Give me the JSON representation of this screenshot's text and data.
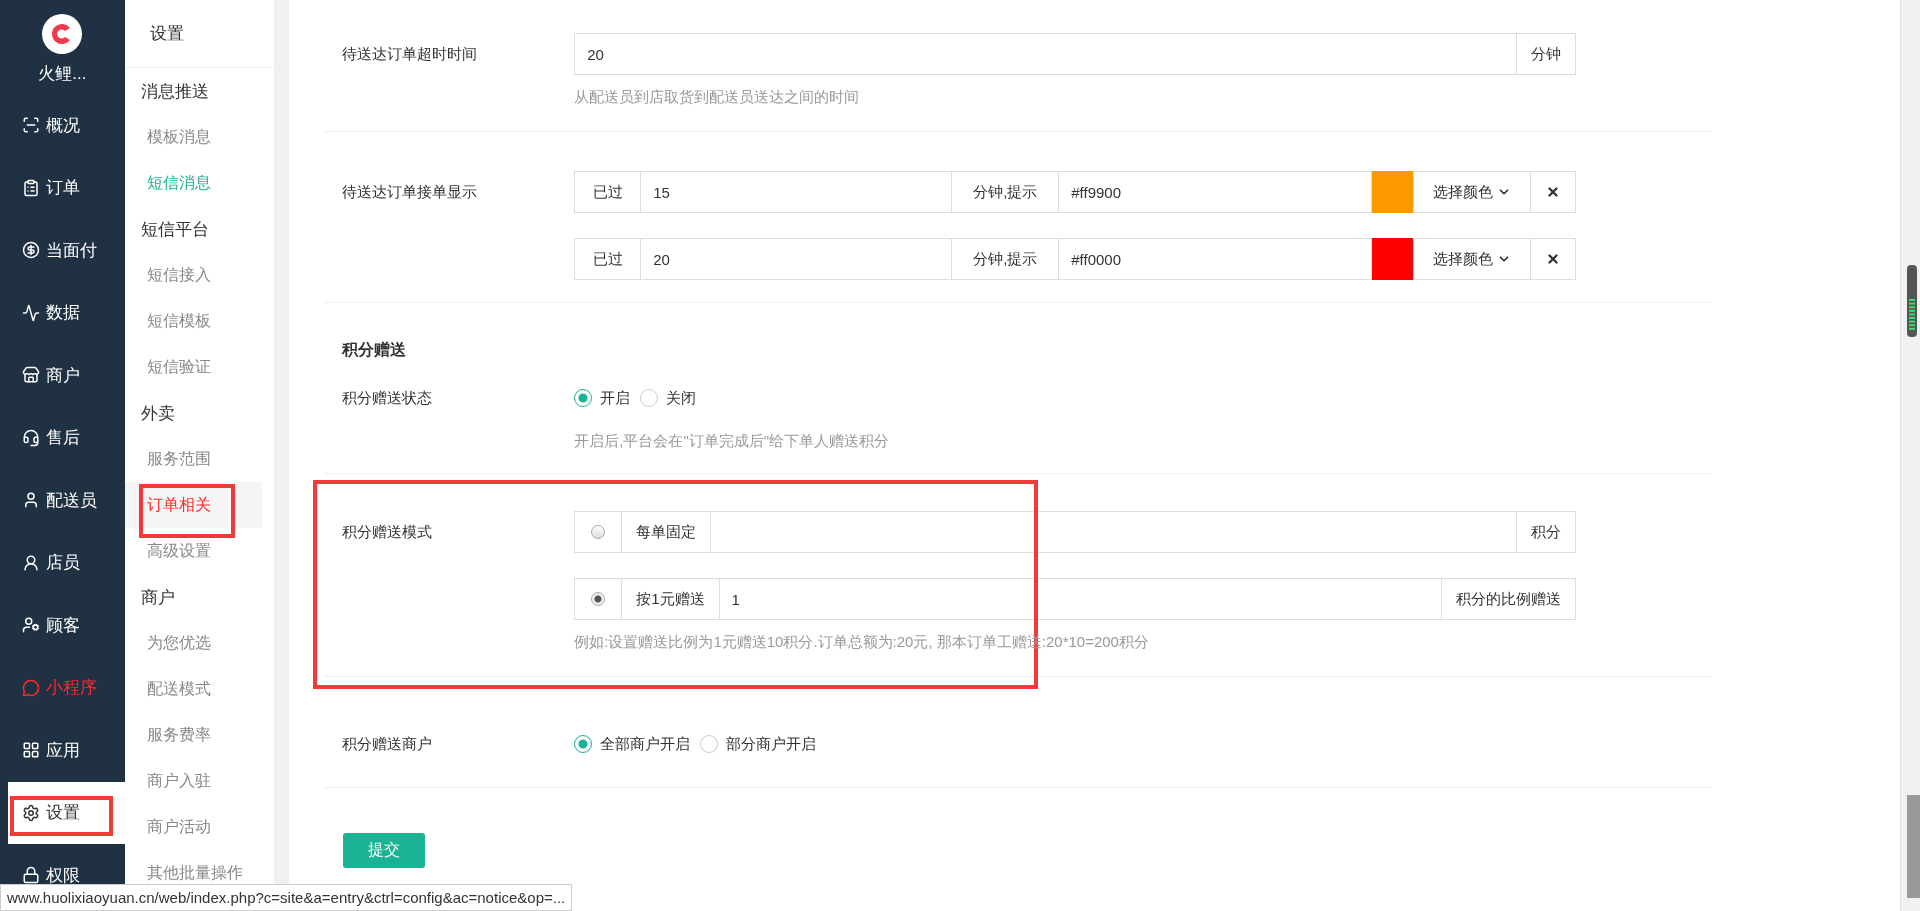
{
  "brand": {
    "name": "火鲤..."
  },
  "sidebar": {
    "items": [
      {
        "label": "概况",
        "selected": false,
        "highlighted": false
      },
      {
        "label": "订单",
        "selected": false,
        "highlighted": false
      },
      {
        "label": "当面付",
        "selected": false,
        "highlighted": false
      },
      {
        "label": "数据",
        "selected": false,
        "highlighted": false
      },
      {
        "label": "商户",
        "selected": false,
        "highlighted": false
      },
      {
        "label": "售后",
        "selected": false,
        "highlighted": false
      },
      {
        "label": "配送员",
        "selected": false,
        "highlighted": false
      },
      {
        "label": "店员",
        "selected": false,
        "highlighted": false
      },
      {
        "label": "顾客",
        "selected": false,
        "highlighted": false
      },
      {
        "label": "小程序",
        "selected": false,
        "highlighted": true
      },
      {
        "label": "应用",
        "selected": false,
        "highlighted": false
      },
      {
        "label": "设置",
        "selected": true,
        "highlighted": false
      },
      {
        "label": "权限",
        "selected": false,
        "highlighted": false
      }
    ]
  },
  "subnav": {
    "title": "设置",
    "groups": [
      {
        "heading": "消息推送",
        "items": [
          {
            "label": "模板消息",
            "selected": false,
            "highlighted": false
          },
          {
            "label": "短信消息",
            "selected": false,
            "highlighted": true
          }
        ]
      },
      {
        "heading": "短信平台",
        "items": [
          {
            "label": "短信接入",
            "selected": false,
            "highlighted": false
          },
          {
            "label": "短信模板",
            "selected": false,
            "highlighted": false
          },
          {
            "label": "短信验证",
            "selected": false,
            "highlighted": false
          }
        ]
      },
      {
        "heading": "外卖",
        "items": [
          {
            "label": "服务范围",
            "selected": false,
            "highlighted": false
          },
          {
            "label": "订单相关",
            "selected": true,
            "highlighted": false
          },
          {
            "label": "高级设置",
            "selected": false,
            "highlighted": false
          }
        ]
      },
      {
        "heading": "商户",
        "items": [
          {
            "label": "为您优选",
            "selected": false,
            "highlighted": false
          },
          {
            "label": "配送模式",
            "selected": false,
            "highlighted": false
          },
          {
            "label": "服务费率",
            "selected": false,
            "highlighted": false
          },
          {
            "label": "商户入驻",
            "selected": false,
            "highlighted": false
          },
          {
            "label": "商户活动",
            "selected": false,
            "highlighted": false
          },
          {
            "label": "其他批量操作",
            "selected": false,
            "highlighted": false
          }
        ]
      }
    ]
  },
  "form": {
    "rows": [
      {
        "kind": "input",
        "label": "待送达订单超时时间",
        "value": "20",
        "addon": "分钟",
        "hint": "从配送员到店取货到配送员送达之间的时间"
      },
      {
        "kind": "color-rules",
        "label": "待送达订单接单显示",
        "rules": [
          {
            "prefix": "已过",
            "value": "15",
            "middle": "分钟,提示",
            "color_text": "#ff9900",
            "color": "#ff9900",
            "button": "选择颜色"
          },
          {
            "prefix": "已过",
            "value": "20",
            "middle": "分钟,提示",
            "color_text": "#ff0000",
            "color": "#ff0000",
            "button": "选择颜色"
          }
        ]
      },
      {
        "kind": "section",
        "label": "积分赠送"
      },
      {
        "kind": "radio",
        "label": "积分赠送状态",
        "options": [
          {
            "label": "开启",
            "selected": true
          },
          {
            "label": "关闭",
            "selected": false
          }
        ],
        "hint": "开启后,平台会在\"订单完成后\"给下单人赠送积分"
      },
      {
        "kind": "mode",
        "label": "积分赠送模式",
        "options": [
          {
            "label": "每单固定",
            "selected": false,
            "addon": "积分"
          },
          {
            "label": "按1元赠送",
            "selected": true,
            "value": "1",
            "addon": "积分的比例赠送"
          }
        ],
        "hint": "例如:设置赠送比例为1元赠送10积分.订单总额为:20元, 那本订单工赠送:20*10=200积分"
      },
      {
        "kind": "radio",
        "label": "积分赠送商户",
        "options": [
          {
            "label": "全部商户开启",
            "selected": true
          },
          {
            "label": "部分商户开启",
            "selected": false
          }
        ]
      }
    ],
    "submit": "提交"
  },
  "status_url": "www.huolixiaoyuan.cn/web/index.php?c=site&a=entry&ctrl=config&ac=notice&op=..."
}
